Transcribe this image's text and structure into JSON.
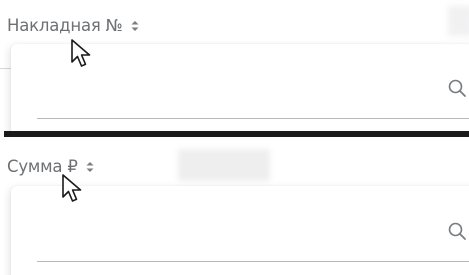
{
  "filters": [
    {
      "header_label": "Накладная №",
      "sort_icon": "sort-up-down-icon",
      "search_value": "",
      "search_placeholder": "",
      "search_icon": "search-icon"
    },
    {
      "header_label": "Сумма ₽",
      "sort_icon": "sort-up-down-icon",
      "search_value": "",
      "search_placeholder": "",
      "search_icon": "search-icon"
    }
  ],
  "pointer": {
    "icon": "mouse-pointer-icon"
  },
  "colors": {
    "header_text": "#6e7074",
    "divider": "#1b1b1b",
    "underline": "#b6b8bc",
    "icon": "#7a7c80"
  }
}
